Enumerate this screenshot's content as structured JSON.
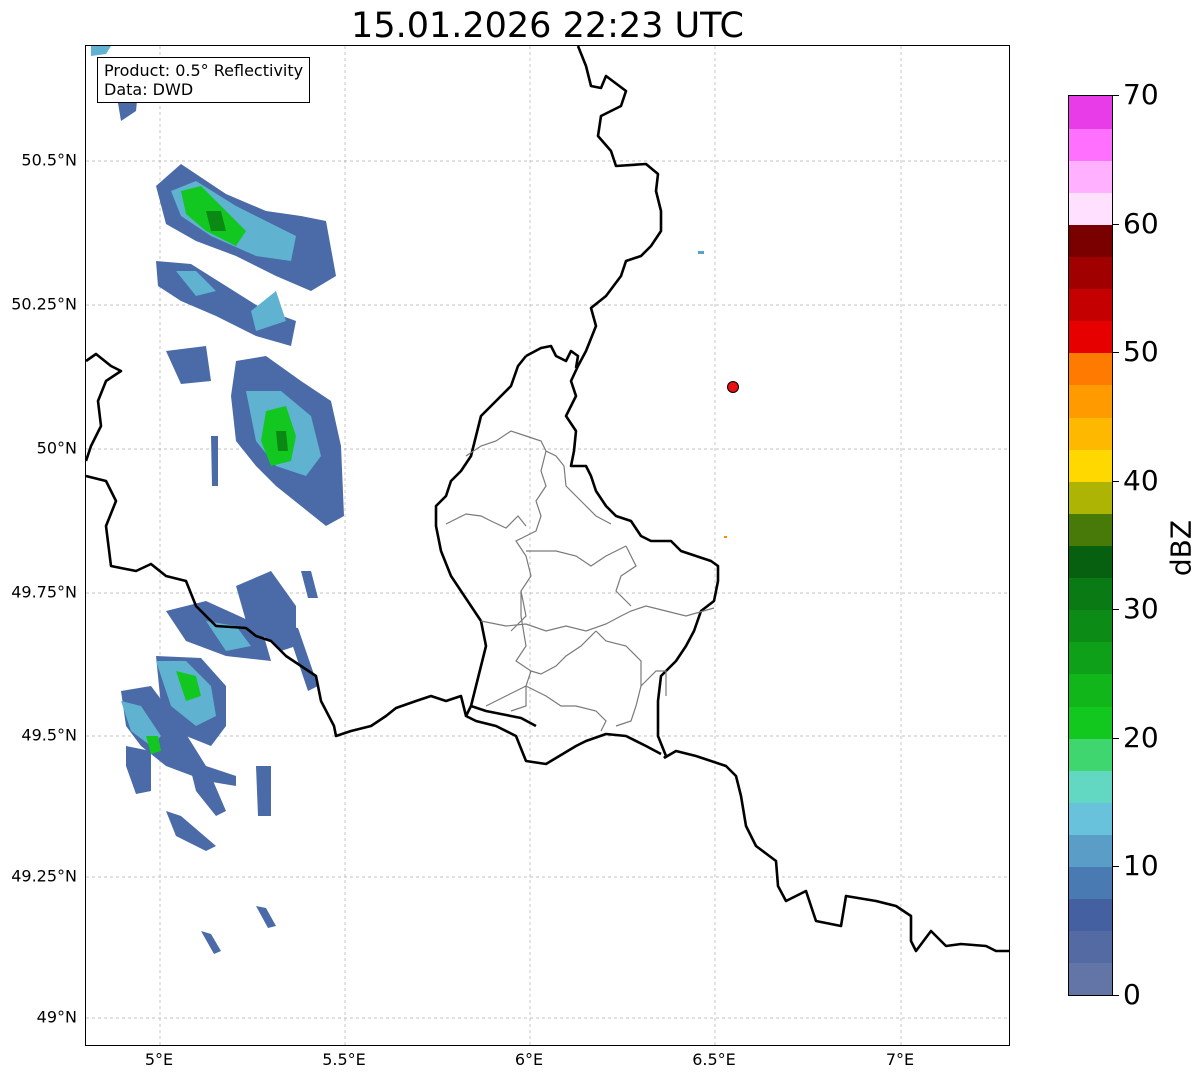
{
  "title": "15.01.2026 22:23 UTC",
  "info_box": {
    "product": "Product: 0.5° Reflectivity",
    "data": "Data: DWD"
  },
  "axes": {
    "lon_labels": [
      "5°E",
      "5.5°E",
      "6°E",
      "6.5°E",
      "7°E"
    ],
    "lat_labels": [
      "50.5°N",
      "50.25°N",
      "50°N",
      "49.75°N",
      "49.5°N",
      "49.25°N",
      "49°N"
    ],
    "lon_values": [
      5.0,
      5.5,
      6.0,
      6.5,
      7.0
    ],
    "lat_values": [
      50.5,
      50.25,
      50.0,
      49.75,
      49.5,
      49.25,
      49.0
    ],
    "lon_range": [
      4.8,
      7.3
    ],
    "lat_range": [
      48.95,
      50.7
    ],
    "grid": true
  },
  "colorbar": {
    "unit": "dBZ",
    "range": [
      0,
      70
    ],
    "tick_labels": [
      "0",
      "10",
      "20",
      "30",
      "40",
      "50",
      "60",
      "70"
    ],
    "tick_values": [
      0,
      10,
      20,
      30,
      40,
      50,
      60,
      70
    ],
    "colors": [
      "#6374a6",
      "#536aa3",
      "#4560a1",
      "#4a7ab2",
      "#5a9ec8",
      "#68c2dc",
      "#62d8c2",
      "#3fd66f",
      "#12c81e",
      "#10b61a",
      "#0fa01a",
      "#0c8c16",
      "#0a7a14",
      "#07600f",
      "#487a0a",
      "#aeb404",
      "#ffd800",
      "#ffb800",
      "#ff9a00",
      "#ff7a00",
      "#e60000",
      "#c40000",
      "#a00000",
      "#7a0000",
      "#ffe0ff",
      "#ffb0ff",
      "#ff70ff",
      "#e83ce8"
    ]
  },
  "marker": {
    "label": "radar-site",
    "lon": 6.55,
    "lat": 50.11,
    "color": "#e81010"
  }
}
